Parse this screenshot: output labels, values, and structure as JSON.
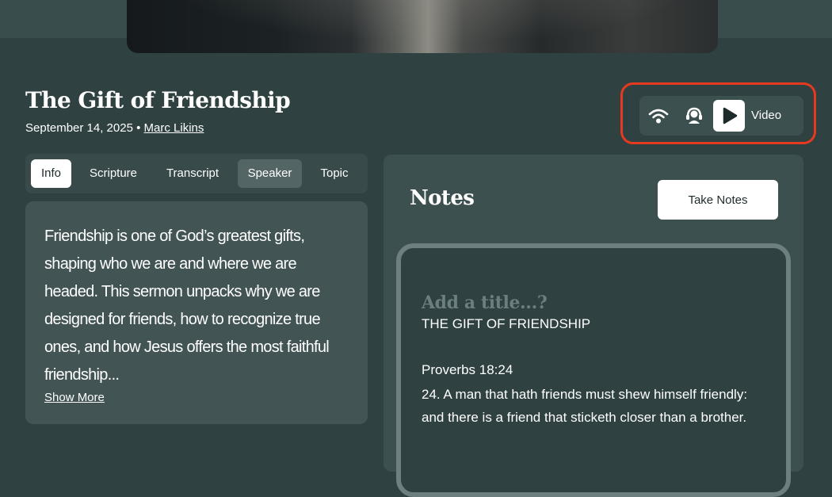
{
  "sermon": {
    "title": "The Gift of Friendship",
    "date": "September 14, 2025",
    "separator": "•",
    "speaker": "Marc Likins"
  },
  "media": {
    "icons": [
      "broadcast-icon",
      "listen-icon",
      "play-icon"
    ],
    "video_label": "Video",
    "highlight_color": "#e53a1f"
  },
  "tabs": [
    {
      "label": "Info",
      "state": "active"
    },
    {
      "label": "Scripture",
      "state": "default"
    },
    {
      "label": "Transcript",
      "state": "default"
    },
    {
      "label": "Speaker",
      "state": "selected"
    },
    {
      "label": "Topic",
      "state": "default"
    }
  ],
  "info": {
    "description": "Friendship is one of God’s greatest gifts, shaping who we are and where we are headed. This sermon unpacks why we are designed for friends, how to recognize true ones, and how Jesus offers the most faithful friendship...",
    "show_more": "Show More"
  },
  "notes": {
    "title": "Notes",
    "take_notes_label": "Take Notes",
    "title_placeholder": "Add a title...?",
    "heading": "THE GIFT OF FRIENDSHIP",
    "reference": "Proverbs 18:24",
    "verse": "24. A man that hath friends must shew himself friendly: and there is a friend that sticketh closer than a brother."
  },
  "colors": {
    "background": "#2f4141",
    "panel": "#3d5050",
    "card": "#425454",
    "accent_white": "#ffffff"
  }
}
